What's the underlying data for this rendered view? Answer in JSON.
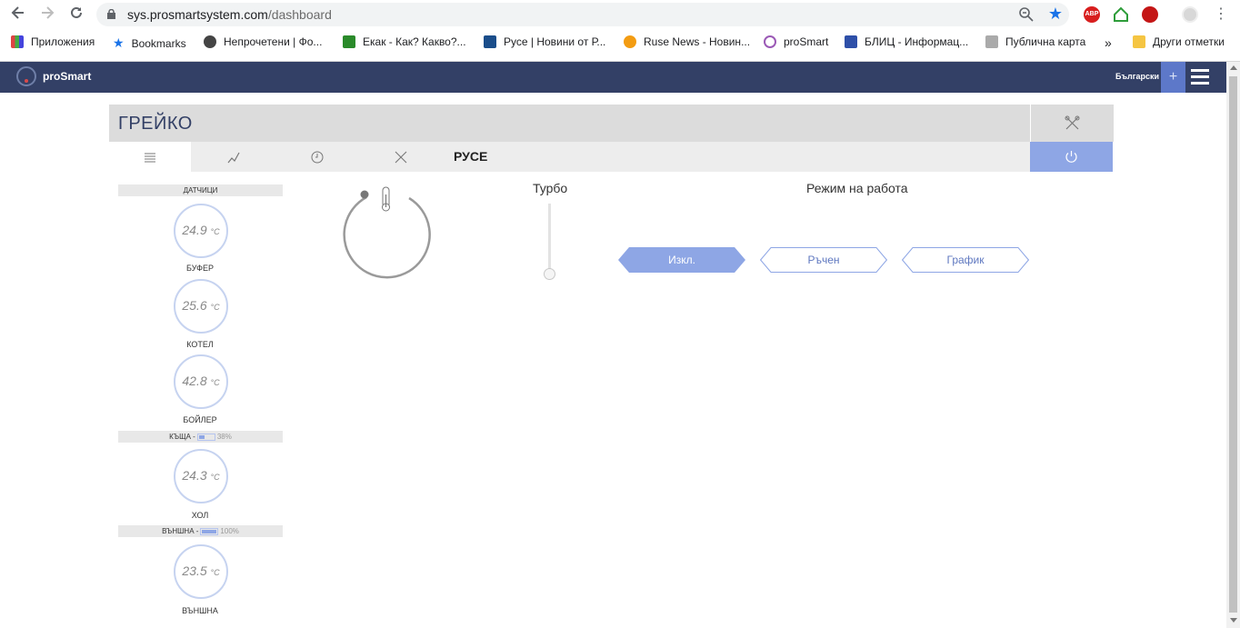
{
  "browser": {
    "url_host": "sys.prosmartsystem.com",
    "url_path": "/dashboard",
    "nav_icons": [
      "back-icon",
      "forward-icon",
      "reload-icon"
    ],
    "extensions": [
      {
        "name": "adblock-icon",
        "color": "#d81e1e",
        "label": "ABP"
      },
      {
        "name": "home-ext-icon",
        "color": "#2e9d3a"
      },
      {
        "name": "ublock-icon",
        "color": "#c41616"
      }
    ],
    "bookmarks": [
      {
        "label": "Приложения",
        "icon": "apps-grid-icon",
        "color": "#d44"
      },
      {
        "label": "Bookmarks",
        "icon": "star-icon",
        "color": "#1a73e8"
      },
      {
        "label": "Непрочетени | Фо...",
        "icon": "globe-icon",
        "color": "#444"
      },
      {
        "label": "Екак - Как? Какво?...",
        "icon": "site-icon",
        "color": "#2a8a2a"
      },
      {
        "label": "Русе | Новини от Р...",
        "icon": "site-d-icon",
        "color": "#1a4d8a"
      },
      {
        "label": "Ruse News - Новин...",
        "icon": "refresh-site-icon",
        "color": "#f39c12"
      },
      {
        "label": "proSmart",
        "icon": "prosmart-icon",
        "color": "#9b59b6"
      },
      {
        "label": "БЛИЦ - Информац...",
        "icon": "blic-icon",
        "color": "#2e4fa8"
      },
      {
        "label": "Публична карта",
        "icon": "map-icon",
        "color": "#999"
      },
      {
        "label": "»",
        "icon": "more-icon",
        "color": "#444"
      },
      {
        "label": "Други отметки",
        "icon": "folder-icon",
        "color": "#f5c542"
      }
    ]
  },
  "app": {
    "logo": "proSmart",
    "language": "Български",
    "plus_label": "+"
  },
  "device": {
    "title": "ГРЕЙКО",
    "location": "РУСЕ",
    "tabs": [
      {
        "name": "tab-list",
        "icon": "list-icon",
        "active": true
      },
      {
        "name": "tab-chart",
        "icon": "chart-icon",
        "active": false
      },
      {
        "name": "tab-clock",
        "icon": "clock-icon",
        "active": false
      },
      {
        "name": "tab-tools",
        "icon": "tools-icon",
        "active": false
      }
    ],
    "accent_color": "#8ea6e5"
  },
  "sensors": {
    "section1": "ДАТЧИЦИ",
    "items1": [
      {
        "value": "24.9",
        "unit": "°C",
        "label": "БУФЕР"
      },
      {
        "value": "25.6",
        "unit": "°C",
        "label": "КОТЕЛ"
      },
      {
        "value": "42.8",
        "unit": "°C",
        "label": "БОЙЛЕР"
      }
    ],
    "section2": {
      "label": "КЪЩА -",
      "battery": "38%",
      "battery_level": 0.38
    },
    "items2": [
      {
        "value": "24.3",
        "unit": "°C",
        "label": "ХОЛ"
      }
    ],
    "section3": {
      "label": "ВЪНШНА -",
      "battery": "100%",
      "battery_level": 1.0
    },
    "items3": [
      {
        "value": "23.5",
        "unit": "°C",
        "label": "ВЪНШНА"
      }
    ]
  },
  "controls": {
    "turbo_label": "Турбо",
    "turbo_level": 0,
    "mode_label": "Режим на работа",
    "modes": [
      {
        "label": "Изкл.",
        "active": true
      },
      {
        "label": "Ръчен",
        "active": false
      },
      {
        "label": "График",
        "active": false
      }
    ]
  }
}
